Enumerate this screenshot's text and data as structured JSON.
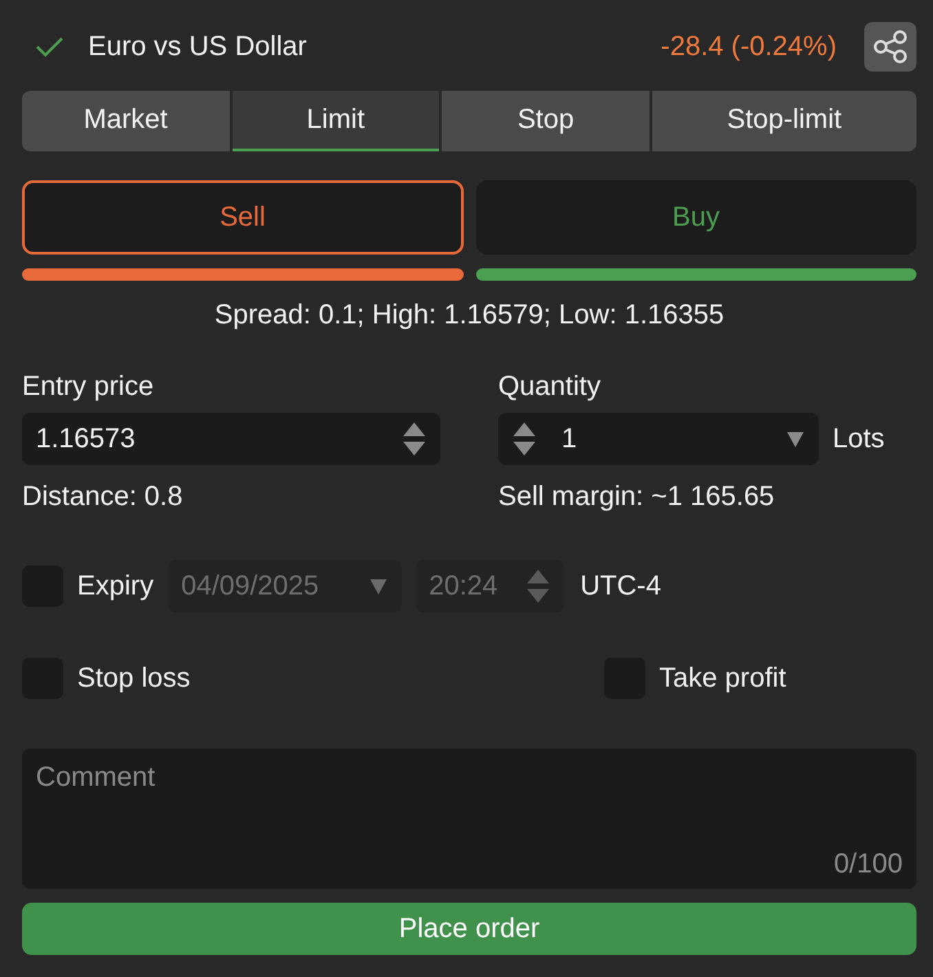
{
  "header": {
    "title": "Euro vs US Dollar",
    "change": "-28.4 (-0.24%)"
  },
  "tabs": [
    {
      "label": "Market",
      "selected": false
    },
    {
      "label": "Limit",
      "selected": true
    },
    {
      "label": "Stop",
      "selected": false
    },
    {
      "label": "Stop-limit",
      "selected": false
    }
  ],
  "sides": [
    {
      "label": "Sell",
      "selected": true,
      "color": "#e8693a"
    },
    {
      "label": "Buy",
      "selected": false,
      "color": "#4c9e50"
    }
  ],
  "stats": "Spread: 0.1; High: 1.16579; Low: 1.16355",
  "entry": {
    "label": "Entry price",
    "value": "1.16573",
    "note": "Distance: 0.8"
  },
  "quantity": {
    "label": "Quantity",
    "value": "1",
    "unit": "Lots",
    "note": "Sell margin: ~1 165.65"
  },
  "expiry": {
    "label": "Expiry",
    "checked": false,
    "date": "04/09/2025",
    "time": "20:24",
    "timezone": "UTC-4"
  },
  "options": [
    {
      "label": "Stop loss",
      "checked": false
    },
    {
      "label": "Take profit",
      "checked": false
    }
  ],
  "comment": {
    "placeholder": "Comment",
    "counter": "0/100"
  },
  "submit": "Place order"
}
